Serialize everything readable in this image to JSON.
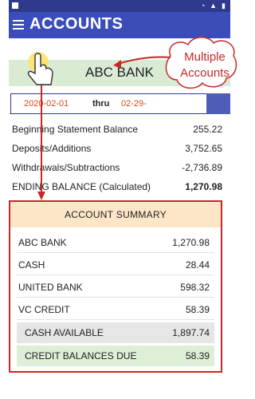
{
  "app": {
    "title": "ACCOUNTS",
    "account_selected": "ABC BANK"
  },
  "date_range": {
    "from": "2020-02-01",
    "thru_label": "thru",
    "to": "02-29-"
  },
  "balances": [
    {
      "label": "Beginning Statement Balance",
      "value": "255.22"
    },
    {
      "label": "Deposits/Additions",
      "value": "3,752.65"
    },
    {
      "label": "Withdrawals/Subtractions",
      "value": "-2,736.89"
    },
    {
      "label": "ENDING BALANCE (Calculated)",
      "value": "1,270.98"
    }
  ],
  "summary": {
    "title": "ACCOUNT SUMMARY",
    "rows": [
      {
        "label": "ABC BANK",
        "value": "1,270.98"
      },
      {
        "label": "CASH",
        "value": "28.44"
      },
      {
        "label": "UNITED BANK",
        "value": "598.32"
      },
      {
        "label": "VC CREDIT",
        "value": "58.39"
      }
    ],
    "cash_available": {
      "label": "CASH AVAILABLE",
      "value": "1,897.74"
    },
    "credit_due": {
      "label": "CREDIT BALANCES DUE",
      "value": "58.39"
    }
  },
  "annotation": {
    "line1": "Multiple",
    "line2": "Accounts"
  },
  "colors": {
    "app_bar": "#3b4db8",
    "account_bar": "#d9ecd3",
    "summary_header": "#fde6c8",
    "highlight_red": "#c62828",
    "date_text": "#d24b1a"
  }
}
